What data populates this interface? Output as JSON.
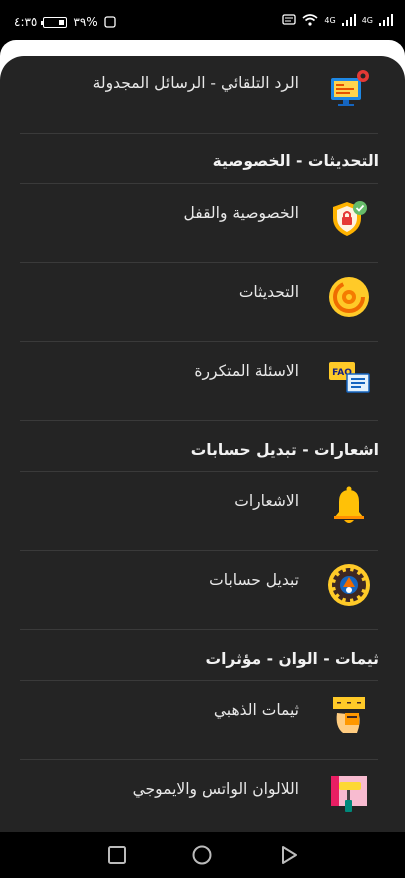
{
  "status": {
    "time": "٤:٣٥",
    "battery": "٣٩%",
    "network1": "4G",
    "network2": "4G"
  },
  "items": [
    {
      "label": "الرد التلقائي - الرسائل المجدولة",
      "icon": "monitor-gear-icon"
    },
    {
      "label": "الخصوصية والقفل",
      "icon": "shield-lock-icon"
    },
    {
      "label": "التحديثات",
      "icon": "update-gear-icon"
    },
    {
      "label": "الاسئلة المتكررة",
      "icon": "faq-icon"
    },
    {
      "label": "الاشعارات",
      "icon": "bell-icon"
    },
    {
      "label": "تبديل حسابات",
      "icon": "switch-account-gear-icon"
    },
    {
      "label": "ثيمات الذهبي",
      "icon": "gold-theme-icon"
    },
    {
      "label": "اللالوان الواتس والايموجي",
      "icon": "paint-roller-icon"
    }
  ],
  "sections": {
    "privacy": "التحديثات - الخصوصية",
    "notifications": "اشعارات - تبديل حسابات",
    "themes": "ثيمات - الوان - مؤثرات"
  },
  "colors": {
    "sheet": "#242424",
    "divider": "#3a3a3a",
    "accent_gold": "#f5c31b"
  }
}
